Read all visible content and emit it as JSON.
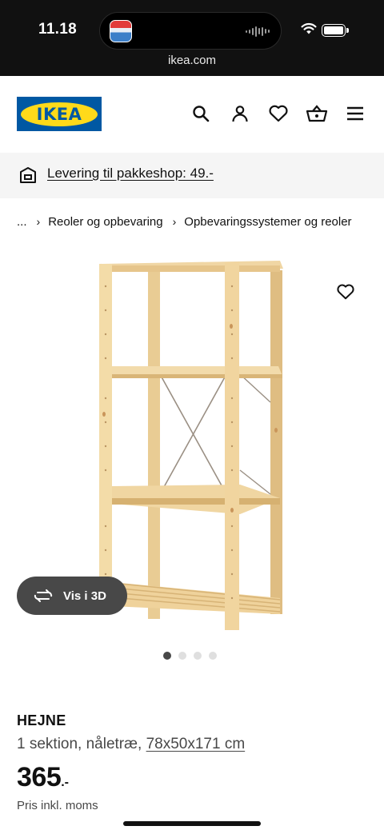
{
  "status_bar": {
    "time": "11.18",
    "url": "ikea.com",
    "signal_bars": [
      3,
      5,
      9,
      13,
      8,
      11,
      6,
      4
    ]
  },
  "header": {
    "logo_text": "IKEA",
    "icons": [
      "search-icon",
      "user-icon",
      "heart-icon",
      "shopping-bag-icon",
      "menu-icon"
    ]
  },
  "delivery": {
    "text": "Levering til pakkeshop: 49.-"
  },
  "breadcrumb": {
    "items": [
      "...",
      "Reoler og opbevaring",
      "Opbevaringssystemer og reoler"
    ]
  },
  "gallery": {
    "view_3d_label": "Vis i 3D",
    "dot_count": 4,
    "active_index": 0
  },
  "product": {
    "name": "HEJNE",
    "description": "1 sektion, nåletræ, ",
    "dimensions": "78x50x171 cm",
    "price": "365",
    "price_suffix": ".-",
    "price_note": "Pris inkl. moms"
  },
  "colors": {
    "ikea_blue": "#0058a3",
    "ikea_yellow": "#ffda1a",
    "wood": "#ecd09a"
  }
}
